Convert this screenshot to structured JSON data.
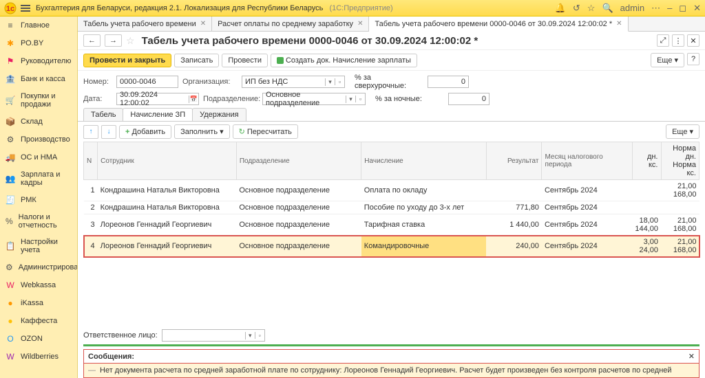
{
  "titlebar": {
    "app_title": "Бухгалтерия для Беларуси, редакция 2.1. Локализация для Республики Беларусь",
    "app_sub": "(1С:Предприятие)",
    "user": "admin"
  },
  "sidebar": {
    "items": [
      {
        "icon": "≡",
        "label": "Главное",
        "color": "#555"
      },
      {
        "icon": "✱",
        "label": "РО.BY",
        "color": "#ff9800"
      },
      {
        "icon": "⚑",
        "label": "Руководителю",
        "color": "#e91e63"
      },
      {
        "icon": "🏦",
        "label": "Банк и касса",
        "color": "#4caf50"
      },
      {
        "icon": "🛒",
        "label": "Покупки и продажи",
        "color": "#555"
      },
      {
        "icon": "📦",
        "label": "Склад",
        "color": "#795548"
      },
      {
        "icon": "⚙",
        "label": "Производство",
        "color": "#555"
      },
      {
        "icon": "🚚",
        "label": "ОС и НМА",
        "color": "#555"
      },
      {
        "icon": "👥",
        "label": "Зарплата и кадры",
        "color": "#555"
      },
      {
        "icon": "🧾",
        "label": "РМК",
        "color": "#795548"
      },
      {
        "icon": "%",
        "label": "Налоги и отчетность",
        "color": "#555"
      },
      {
        "icon": "📋",
        "label": "Настройки учета",
        "color": "#555"
      },
      {
        "icon": "⚙",
        "label": "Администрирование",
        "color": "#555"
      },
      {
        "icon": "W",
        "label": "Webkassa",
        "color": "#e91e63"
      },
      {
        "icon": "●",
        "label": "iKassa",
        "color": "#ff9800"
      },
      {
        "icon": "●",
        "label": "Каффеста",
        "color": "#ffc107"
      },
      {
        "icon": "O",
        "label": "OZON",
        "color": "#2196f3"
      },
      {
        "icon": "W",
        "label": "Wildberries",
        "color": "#9c27b0"
      }
    ]
  },
  "tabs": [
    {
      "label": "Табель учета рабочего времени",
      "active": false
    },
    {
      "label": "Расчет оплаты по среднему заработку",
      "active": false
    },
    {
      "label": "Табель учета рабочего времени 0000-0046 от 30.09.2024 12:00:02 *",
      "active": true
    }
  ],
  "doc": {
    "title": "Табель учета рабочего времени 0000-0046 от 30.09.2024 12:00:02 *",
    "nav_back": "←",
    "nav_fwd": "→"
  },
  "toolbar": {
    "post_close": "Провести и закрыть",
    "save": "Записать",
    "post": "Провести",
    "create_doc": "Создать док. Начисление зарплаты",
    "more": "Еще"
  },
  "fields": {
    "number_label": "Номер:",
    "number": "0000-0046",
    "org_label": "Организация:",
    "org": "ИП без НДС",
    "overtime_label": "% за сверхурочные:",
    "overtime": "0",
    "date_label": "Дата:",
    "date": "30.09.2024 12:00:02",
    "dept_label": "Подразделение:",
    "dept": "Основное подразделение",
    "night_label": "% за ночные:",
    "night": "0"
  },
  "inner_tabs": [
    "Табель",
    "Начисление ЗП",
    "Удержания"
  ],
  "inner_toolbar": {
    "add": "Добавить",
    "fill": "Заполнить",
    "recalc": "Пересчитать",
    "more": "Еще"
  },
  "table": {
    "headers": {
      "n": "N",
      "employee": "Сотрудник",
      "dept": "Подразделение",
      "accrual": "Начисление",
      "result": "Результат",
      "period": "Месяц налогового периода",
      "dn": "дн.",
      "kc": "кс.",
      "norm_dn": "Норма дн.",
      "norm_kc": "Норма кс."
    },
    "rows": [
      {
        "n": "1",
        "emp": "Кондрашина Наталья Викторовна",
        "dept": "Основное подразделение",
        "acc": "Оплата по окладу",
        "res": "",
        "period": "Сентябрь 2024",
        "dn": "",
        "kc": "",
        "ndn": "21,00",
        "nkc": "168,00"
      },
      {
        "n": "2",
        "emp": "Кондрашина Наталья Викторовна",
        "dept": "Основное подразделение",
        "acc": "Пособие по уходу до 3-х лет",
        "res": "771,80",
        "period": "Сентябрь 2024",
        "dn": "",
        "kc": "",
        "ndn": "",
        "nkc": ""
      },
      {
        "n": "3",
        "emp": "Лореонов Геннадий Георгиевич",
        "dept": "Основное подразделение",
        "acc": "Тарифная ставка",
        "res": "1 440,00",
        "period": "Сентябрь 2024",
        "dn": "18,00",
        "kc": "144,00",
        "ndn": "21,00",
        "nkc": "168,00"
      },
      {
        "n": "4",
        "emp": "Лореонов Геннадий Георгиевич",
        "dept": "Основное подразделение",
        "acc": "Командировочные",
        "res": "240,00",
        "period": "Сентябрь 2024",
        "dn": "3,00",
        "kc": "24,00",
        "ndn": "21,00",
        "nkc": "168,00"
      }
    ]
  },
  "footer": {
    "resp_label": "Ответственное лицо:",
    "resp": ""
  },
  "messages": {
    "title": "Сообщения:",
    "body": "Нет документа расчета по средней заработной плате по сотруднику: Лореонов Геннадий Георгиевич. Расчет будет произведен без контроля расчетов по средней"
  }
}
